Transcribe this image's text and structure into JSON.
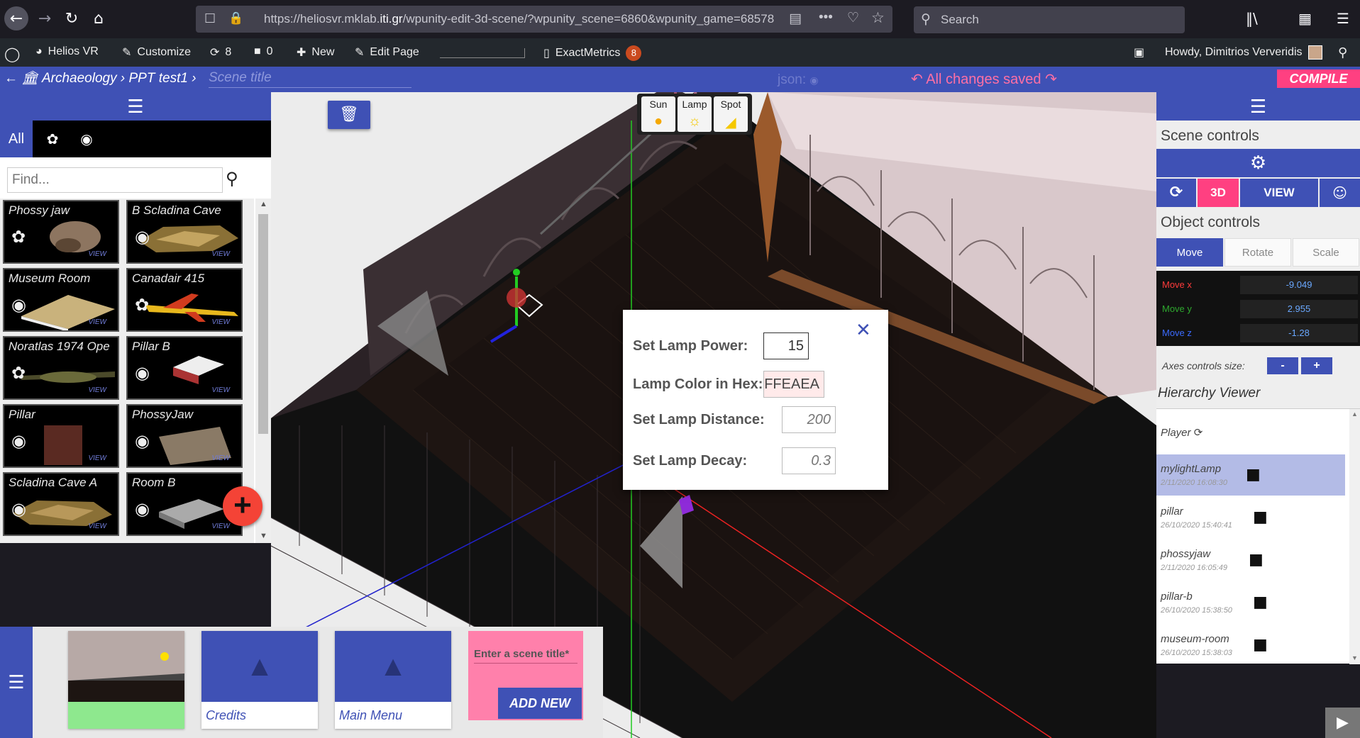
{
  "browser": {
    "url_prefix": "https://heliosvr.mklab.",
    "url_domain": "iti.gr",
    "url_rest": "/wpunity-edit-3d-scene/?wpunity_scene=6860&wpunity_game=68578",
    "search_placeholder": "Search"
  },
  "adminbar": {
    "site": "Helios VR",
    "customize": "Customize",
    "updates": "8",
    "comments": "0",
    "new": "New",
    "edit_page": "Edit Page",
    "exactmetrics": "ExactMetrics",
    "exactmetrics_badge": "8",
    "howdy": "Howdy, Dimitrios Ververidis"
  },
  "editor": {
    "crumb_1": "Archaeology",
    "crumb_2": "PPT test1",
    "title_placeholder": "Scene title",
    "json_label": "json:",
    "saved_status": "All changes saved",
    "compile_label": "COMPILE"
  },
  "library": {
    "tab_all": "All",
    "find_placeholder": "Find...",
    "view_label": "VIEW",
    "assets": [
      {
        "name": "Phossy jaw",
        "icon": "paw-icon"
      },
      {
        "name": "B Scladina Cave",
        "icon": "pin-icon"
      },
      {
        "name": "Museum Room",
        "icon": "pin-icon"
      },
      {
        "name": "Canadair 415",
        "icon": "paw-icon"
      },
      {
        "name": "Noratlas 1974 Ope",
        "icon": "paw-icon"
      },
      {
        "name": "Pillar B",
        "icon": "pin-icon"
      },
      {
        "name": "Pillar",
        "icon": "pin-icon"
      },
      {
        "name": "PhossyJaw",
        "icon": "pin-icon"
      },
      {
        "name": "Scladina Cave A",
        "icon": "pin-icon"
      },
      {
        "name": "Room B",
        "icon": "pin-icon"
      }
    ]
  },
  "scenes": {
    "credits": "Credits",
    "main_menu": "Main Menu",
    "new_placeholder": "Enter a scene title*",
    "add_new": "ADD NEW"
  },
  "lights": {
    "sun": "Sun",
    "lamp": "Lamp",
    "spot": "Spot"
  },
  "lamp_dialog": {
    "power_label": "Set Lamp Power:",
    "power_value": "15",
    "color_label": "Lamp Color in Hex:",
    "color_value": "FFEAEA",
    "distance_label": "Set Lamp Distance:",
    "distance_value": "200",
    "decay_label": "Set Lamp Decay:",
    "decay_value": "0.3"
  },
  "right": {
    "scene_controls": "Scene controls",
    "view_3d": "3D",
    "view_view": "VIEW",
    "object_controls": "Object controls",
    "move": "Move",
    "rotate": "Rotate",
    "scale": "Scale",
    "move_x_label": "Move x",
    "move_x": "-9.049",
    "move_y_label": "Move y",
    "move_y": "2.955",
    "move_z_label": "Move z",
    "move_z": "-1.28",
    "axes_label": "Axes controls size:",
    "minus": "-",
    "plus": "+",
    "hierarchy": "Hierarchy Viewer",
    "player": "Player",
    "items": [
      {
        "name": "mylightLamp",
        "date": "2/11/2020 16:08:30"
      },
      {
        "name": "pillar",
        "date": "26/10/2020 15:40:41"
      },
      {
        "name": "phossyjaw",
        "date": "2/11/2020 16:05:49"
      },
      {
        "name": "pillar-b",
        "date": "26/10/2020 15:38:50"
      },
      {
        "name": "museum-room",
        "date": "26/10/2020 15:38:03"
      }
    ]
  },
  "colors": {
    "accent": "#3f51b5",
    "pink": "#ff4081",
    "selected_row": "#b3bbe6",
    "move_x": "#ff3b3b",
    "move_y": "#2ea82e",
    "move_z": "#3b6bff"
  }
}
